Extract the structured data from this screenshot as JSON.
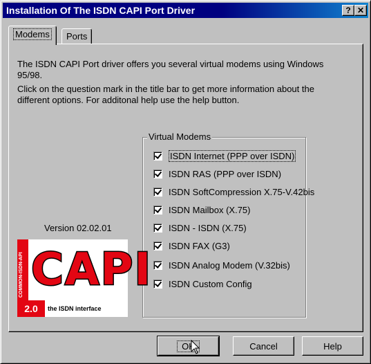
{
  "window": {
    "title": "Installation Of The ISDN CAPI Port Driver",
    "help_button": "?",
    "close_button": "✕"
  },
  "tabs": [
    {
      "label": "Modems",
      "active": true
    },
    {
      "label": "Ports",
      "active": false
    }
  ],
  "description": {
    "line1": "The ISDN CAPI Port driver offers you several virtual modems using Windows",
    "line2": "95/98.",
    "line3": "Click on the question mark in the title bar to get more information about the",
    "line4": "different options. For additonal help use the help button."
  },
  "version": "Version 02.02.01",
  "logo": {
    "side_text": "COMMON-ISDN-API",
    "main_text": "CAPI",
    "version_text": "2.0",
    "tagline": "the ISDN interface"
  },
  "virtual_modems": {
    "label": "Virtual Modems",
    "items": [
      {
        "label": "ISDN Internet (PPP over ISDN)",
        "checked": true
      },
      {
        "label": "ISDN RAS (PPP over ISDN)",
        "checked": true
      },
      {
        "label": "ISDN SoftCompression X.75-V.42bis",
        "checked": true
      },
      {
        "label": "ISDN Mailbox (X.75)",
        "checked": true
      },
      {
        "label": "ISDN - ISDN (X.75)",
        "checked": true
      },
      {
        "label": "ISDN FAX (G3)",
        "checked": true
      },
      {
        "label": "ISDN Analog Modem (V.32bis)",
        "checked": true
      },
      {
        "label": "ISDN Custom Config",
        "checked": true
      }
    ]
  },
  "buttons": {
    "ok": "OK",
    "cancel": "Cancel",
    "help": "Help"
  }
}
